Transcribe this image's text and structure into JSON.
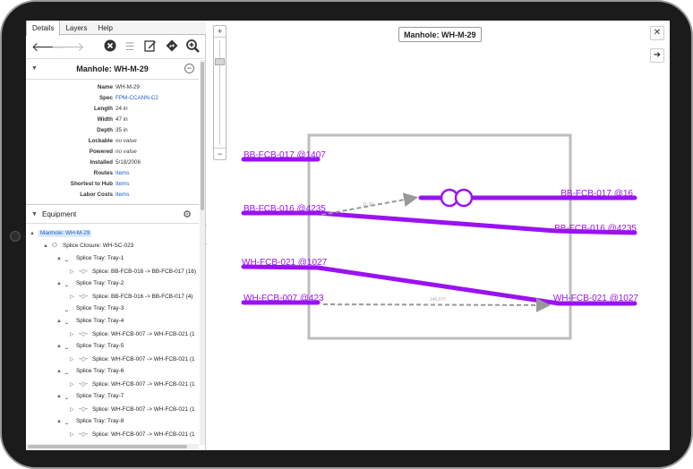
{
  "tabs": [
    "Details",
    "Layers",
    "Help"
  ],
  "toolbar": {
    "back": "back-arrow",
    "forward": "forward-arrow",
    "clear": "close-circle",
    "list": "list",
    "edit": "edit",
    "directions": "directions",
    "zoom": "zoom-in"
  },
  "feature": {
    "title": "Manhole: WH-M-29",
    "attributes": [
      {
        "key": "Name",
        "value": "WH-M-29",
        "style": "plain"
      },
      {
        "key": "Spec",
        "value": "FPM-CCANN-C2",
        "style": "link"
      },
      {
        "key": "Length",
        "value": "24 in",
        "style": "plain"
      },
      {
        "key": "Width",
        "value": "47 in",
        "style": "plain"
      },
      {
        "key": "Depth",
        "value": "35 in",
        "style": "plain"
      },
      {
        "key": "Lockable",
        "value": "no value",
        "style": "muted"
      },
      {
        "key": "Powered",
        "value": "no value",
        "style": "muted"
      },
      {
        "key": "Installed",
        "value": "5/18/2006",
        "style": "plain"
      },
      {
        "key": "Routes",
        "value": "Items",
        "style": "link"
      },
      {
        "key": "Shortest to Hub",
        "value": "Items",
        "style": "link"
      },
      {
        "key": "Labor Costs",
        "value": "Items",
        "style": "link"
      }
    ]
  },
  "equipment": {
    "label": "Equipment",
    "tree": [
      {
        "level": 0,
        "toggle": "▲",
        "icon": "",
        "label": "Manhole: WH-M-29",
        "selected": true
      },
      {
        "level": 1,
        "toggle": "▲",
        "icon": "closure",
        "label": "Splice Closure: WH-SC-023",
        "selected": false
      },
      {
        "level": 2,
        "toggle": "▲",
        "icon": "tray",
        "label": "Splice Tray: Tray-1",
        "selected": false
      },
      {
        "level": 3,
        "toggle": "▷",
        "icon": "splice",
        "label": "Splice: BB-FCB-016 -> BB-FCB-017 (16)",
        "selected": false
      },
      {
        "level": 2,
        "toggle": "▲",
        "icon": "tray",
        "label": "Splice Tray: Tray-2",
        "selected": false
      },
      {
        "level": 3,
        "toggle": "▷",
        "icon": "splice",
        "label": "Splice: BB-FCB-016 -> BB-FCB-017 (4)",
        "selected": false
      },
      {
        "level": 2,
        "toggle": "",
        "icon": "tray",
        "label": "Splice Tray: Tray-3",
        "selected": false
      },
      {
        "level": 2,
        "toggle": "▲",
        "icon": "tray",
        "label": "Splice Tray: Tray-4",
        "selected": false
      },
      {
        "level": 3,
        "toggle": "▷",
        "icon": "splice",
        "label": "Splice: WH-FCB-007 -> WH-FCB-021 (1",
        "selected": false
      },
      {
        "level": 2,
        "toggle": "▲",
        "icon": "tray",
        "label": "Splice Tray: Tray-5",
        "selected": false
      },
      {
        "level": 3,
        "toggle": "▷",
        "icon": "splice",
        "label": "Splice: WH-FCB-007 -> WH-FCB-021 (1",
        "selected": false
      },
      {
        "level": 2,
        "toggle": "▲",
        "icon": "tray",
        "label": "Splice Tray: Tray-6",
        "selected": false
      },
      {
        "level": 3,
        "toggle": "▷",
        "icon": "splice",
        "label": "Splice: WH-FCB-007 -> WH-FCB-021 (1",
        "selected": false
      },
      {
        "level": 2,
        "toggle": "▲",
        "icon": "tray",
        "label": "Splice Tray: Tray-7",
        "selected": false
      },
      {
        "level": 3,
        "toggle": "▷",
        "icon": "splice",
        "label": "Splice: WH-FCB-007 -> WH-FCB-021 (1",
        "selected": false
      },
      {
        "level": 2,
        "toggle": "▲",
        "icon": "tray",
        "label": "Splice Tray: Tray-8",
        "selected": false
      },
      {
        "level": 3,
        "toggle": "▷",
        "icon": "splice",
        "label": "Splice: WH-FCB-007 -> WH-FCB-021 (1",
        "selected": false
      }
    ]
  },
  "map": {
    "title": "Manhole: WH-M-29",
    "zoom_in": "+",
    "zoom_out": "−",
    "close": "✕",
    "next": "➜",
    "cable_color": "#9a12f2",
    "manhole_color": "#bdbdbd",
    "link_color": "#999999",
    "cables": [
      {
        "label": "BB-FCB-017 @1407"
      },
      {
        "label": "BB-FCB-016 @4235"
      },
      {
        "label": "WH-FCB-021 @1027"
      },
      {
        "label": "WH-FCB-007 @423"
      },
      {
        "label": "BB-FCB-017 @16"
      },
      {
        "label": "BB-FCB-016 @4235"
      },
      {
        "label": "WH-FCB-021 @1027"
      }
    ],
    "link_labels": [
      "11:30",
      "140.070"
    ]
  }
}
